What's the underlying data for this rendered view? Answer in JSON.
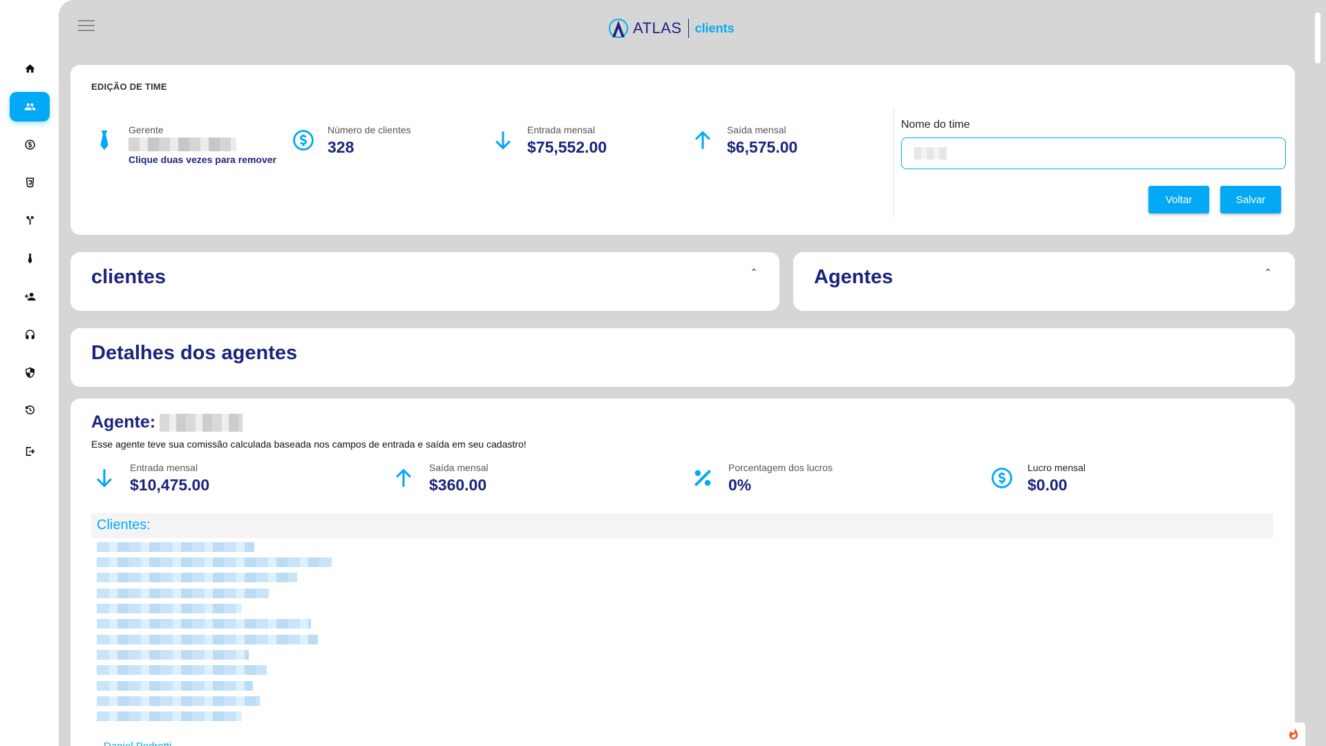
{
  "sidebar": {
    "items": [
      {
        "icon": "home-icon",
        "active": false
      },
      {
        "icon": "people-icon",
        "active": true
      },
      {
        "icon": "dollar-circle-icon",
        "active": false
      },
      {
        "icon": "glass-icon",
        "active": false
      },
      {
        "icon": "merge-icon",
        "active": false
      },
      {
        "icon": "tie-icon",
        "active": false
      },
      {
        "icon": "person-add-icon",
        "active": false
      },
      {
        "icon": "headset-icon",
        "active": false
      },
      {
        "icon": "shield-icon",
        "active": false
      },
      {
        "icon": "history-icon",
        "active": false
      },
      {
        "icon": "logout-icon",
        "active": false
      }
    ]
  },
  "header": {
    "brand": "ATLAS",
    "app_name": "clients"
  },
  "edit_team": {
    "title": "EDIÇÃO DE TIME",
    "manager_label": "Gerente",
    "remove_hint": "Clique duas vezes para remover",
    "clients_count_label": "Número de clientes",
    "clients_count": "328",
    "monthly_in_label": "Entrada mensal",
    "monthly_in": "$75,552.00",
    "monthly_out_label": "Saída mensal",
    "monthly_out": "$6,575.00",
    "team_name_label": "Nome do time",
    "back_button": "Voltar",
    "save_button": "Salvar"
  },
  "sections": {
    "clients_title": "clientes",
    "agents_title": "Agentes",
    "details_title": "Detalhes dos agentes",
    "caret": "ˆ"
  },
  "agent": {
    "title_prefix": "Agente:",
    "note": "Esse agente teve sua comissão calculada baseada nos campos de entrada e saída em seu cadastro!",
    "monthly_in_label": "Entrada mensal",
    "monthly_in": "$10,475.00",
    "monthly_out_label": "Saída mensal",
    "monthly_out": "$360.00",
    "profit_pct_label": "Porcentagem dos lucros",
    "profit_pct": "0%",
    "monthly_profit_label": "Lucro mensal",
    "monthly_profit": "$0.00",
    "clients_label": "Clientes:",
    "last_client": "Daniel Pedrotti"
  },
  "colors": {
    "accent": "#03a9f4",
    "navy": "#1a237e",
    "background": "#d6d6d6"
  }
}
